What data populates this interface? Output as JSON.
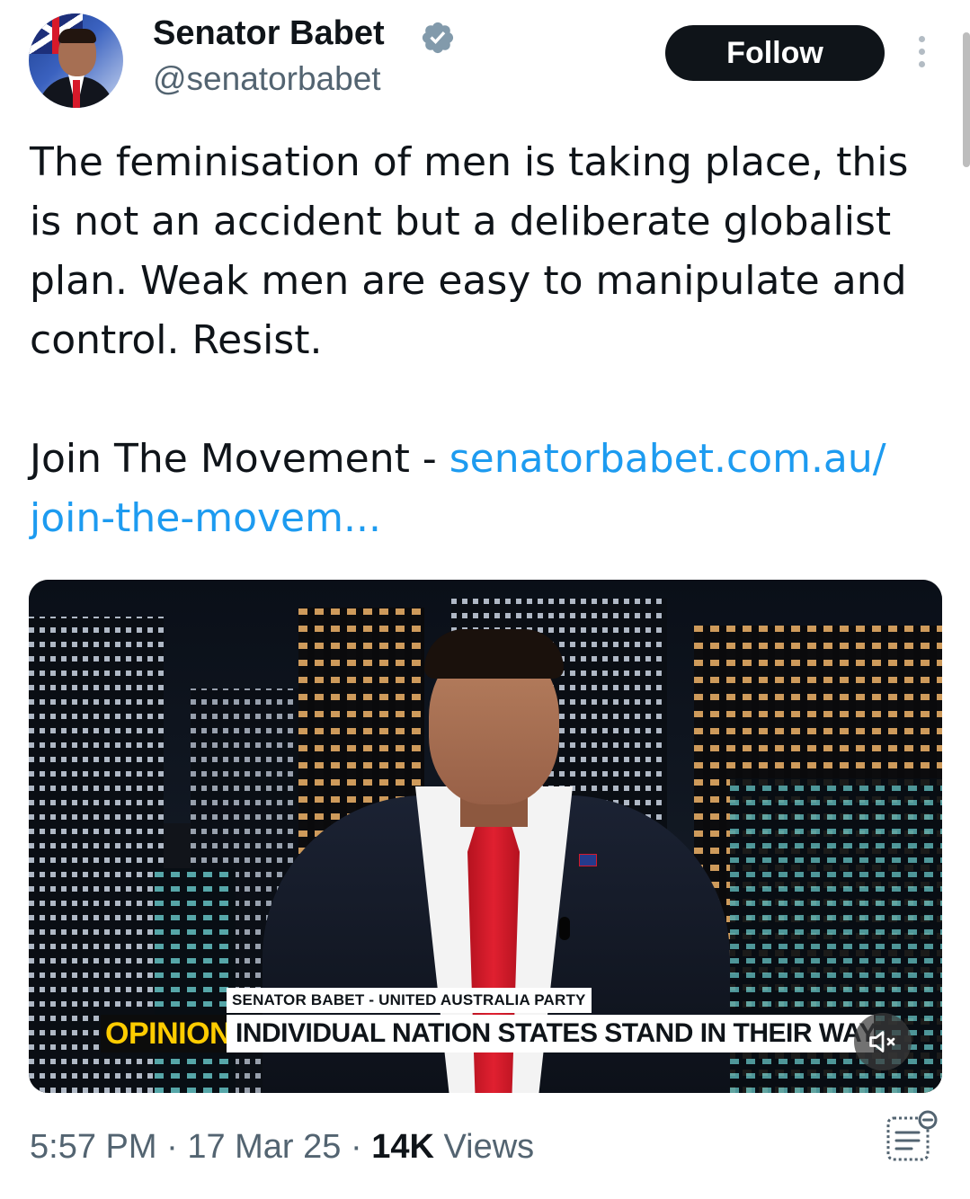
{
  "author": {
    "name": "Senator Babet",
    "handle": "@senatorbabet",
    "verified_icon": "verified-badge-icon",
    "avatar_icon": "profile-avatar"
  },
  "actions": {
    "follow_label": "Follow",
    "more_icon": "vertical-dots-icon"
  },
  "tweet": {
    "line1": "The feminisation of men is taking place, this is not an accident but a deliberate globalist plan. Weak men are easy to manipulate and control. Resist.",
    "join_prefix": "Join The Movement - ",
    "link_text": "senatorbabet.com.au/ join-the-movem..."
  },
  "video": {
    "lower_third_name": "SENATOR BABET - UNITED AUSTRALIA PARTY",
    "tag": "OPINION",
    "headline": "INDIVIDUAL NATION STATES STAND IN THEIR WAY",
    "mute_icon": "speaker-muted-icon"
  },
  "meta": {
    "time": "5:57 PM",
    "sep1": " · ",
    "date": "17 Mar 25",
    "sep2": " · ",
    "views_count": "14K",
    "views_label": " Views",
    "notes_icon": "community-notes-icon"
  },
  "colors": {
    "text": "#0f1419",
    "secondary": "#536471",
    "link": "#1d9bf0",
    "follow_bg": "#0f1419",
    "opinion_yellow": "#ffcc00"
  }
}
